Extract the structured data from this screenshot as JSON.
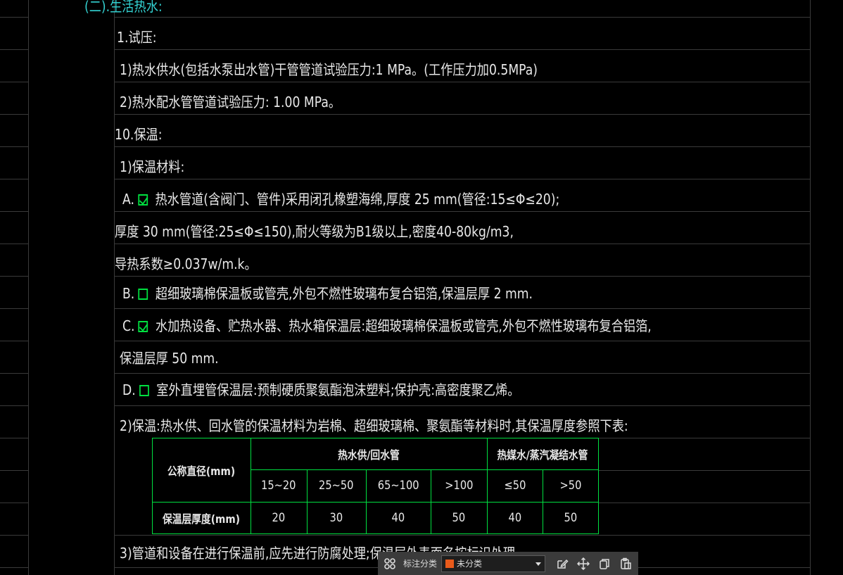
{
  "document": {
    "heading": "(二).生活热水:",
    "lines": [
      "1.试压:",
      "1)热水供水(包括水泵出水管)干管管道试验压力:1  MPa。(工作压力加0.5MPa)",
      "2)热水配水管管道试验压力: 1.00    MPa。",
      "10.保温:",
      "1)保温材料:",
      "热水管道(含阀门、管件)采用闭孔橡塑海绵,厚度 25  mm(管径:15≤Φ≤20);",
      "厚度 30  mm(管径:25≤Φ≤150),耐火等级为B1级以上,密度40-80kg/m3,",
      "导热系数≥0.037w/m.k。",
      "超细玻璃棉保温板或管壳,外包不燃性玻璃布复合铝箔,保温层厚  2  mm.",
      "水加热设备、贮热水器、热水箱保温层:超细玻璃棉保温板或管壳,外包不燃性玻璃布复合铝箔,",
      "保温层厚 50  mm.",
      "室外直埋管保温层:预制硬质聚氨酯泡沫塑料;保护壳:高密度聚乙烯。",
      "2)保温:热水供、回水管的保温材料为岩棉、超细玻璃棉、聚氨酯等材料时,其保温厚度参照下表:",
      "3)管道和设备在进行保温前,应先进行防腐处理;保温层外表面名按标识处理"
    ],
    "options": [
      {
        "letter": "A.",
        "checked": true
      },
      {
        "letter": "B.",
        "checked": false
      },
      {
        "letter": "C.",
        "checked": true
      },
      {
        "letter": "D.",
        "checked": false
      }
    ]
  },
  "table": {
    "row_header": "公称直径(mm)",
    "group1": "热水供/回水管",
    "group2": "热媒水/蒸汽凝结水管",
    "diameters": [
      "15~20",
      "25~50",
      "65~100",
      ">100",
      "≤50",
      ">50"
    ],
    "thickness_label": "保温层厚度(mm)",
    "thickness": [
      "20",
      "30",
      "40",
      "50",
      "40",
      "50"
    ]
  },
  "toolbar": {
    "label": "标注分类",
    "selected": "未分类",
    "color": "#e85a1a"
  },
  "colors": {
    "grid": "#3a3a3a",
    "table_line": "#00e040",
    "heading": "#33d1d1",
    "checkbox": "#00e040"
  }
}
